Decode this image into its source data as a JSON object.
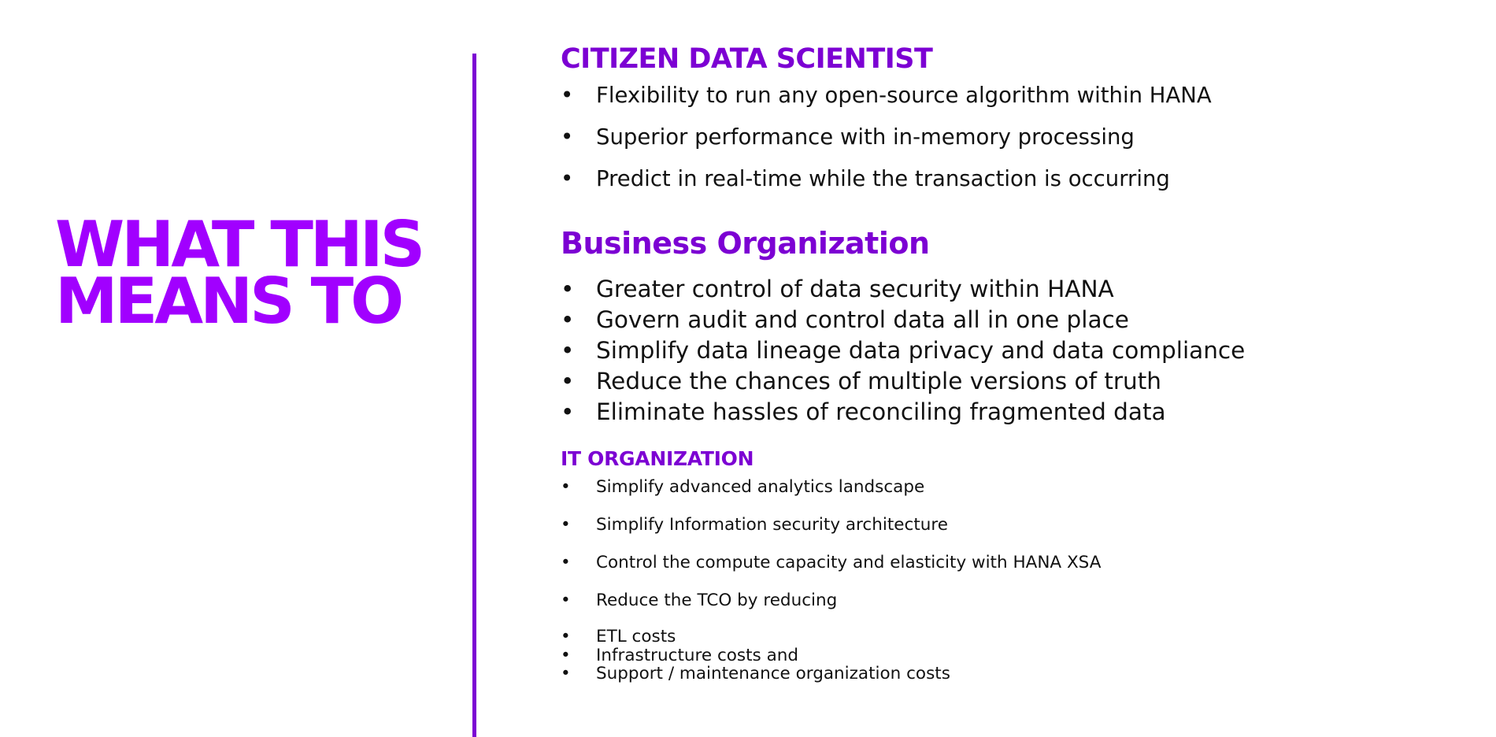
{
  "left": {
    "title_line1": "WHAT THIS",
    "title_line2": "MEANS TO"
  },
  "colors": {
    "accent": "#a100ff",
    "heading": "#7c00d3",
    "text": "#111111",
    "background": "#ffffff"
  },
  "bullet_glyph": "•",
  "citizen": {
    "heading": "CITIZEN DATA SCIENTIST",
    "items": [
      "Flexibility to run any open-source algorithm within HANA",
      "Superior performance with in-memory processing",
      "Predict in real-time while the transaction is occurring"
    ]
  },
  "business": {
    "heading": "Business Organization",
    "items": [
      "Greater control of data security within HANA",
      "Govern audit and control data all in one place",
      "Simplify data lineage data privacy and data compliance",
      "Reduce the chances of multiple versions of truth",
      "Eliminate hassles of reconciling fragmented data"
    ]
  },
  "it": {
    "heading": "IT ORGANIZATION",
    "items": [
      "Simplify advanced analytics landscape",
      "Simplify Information security architecture",
      "Control the compute capacity and elasticity with HANA XSA",
      "Reduce the TCO by reducing"
    ],
    "sub_items": [
      "ETL costs",
      "Infrastructure costs and",
      "Support / maintenance organization costs"
    ]
  }
}
